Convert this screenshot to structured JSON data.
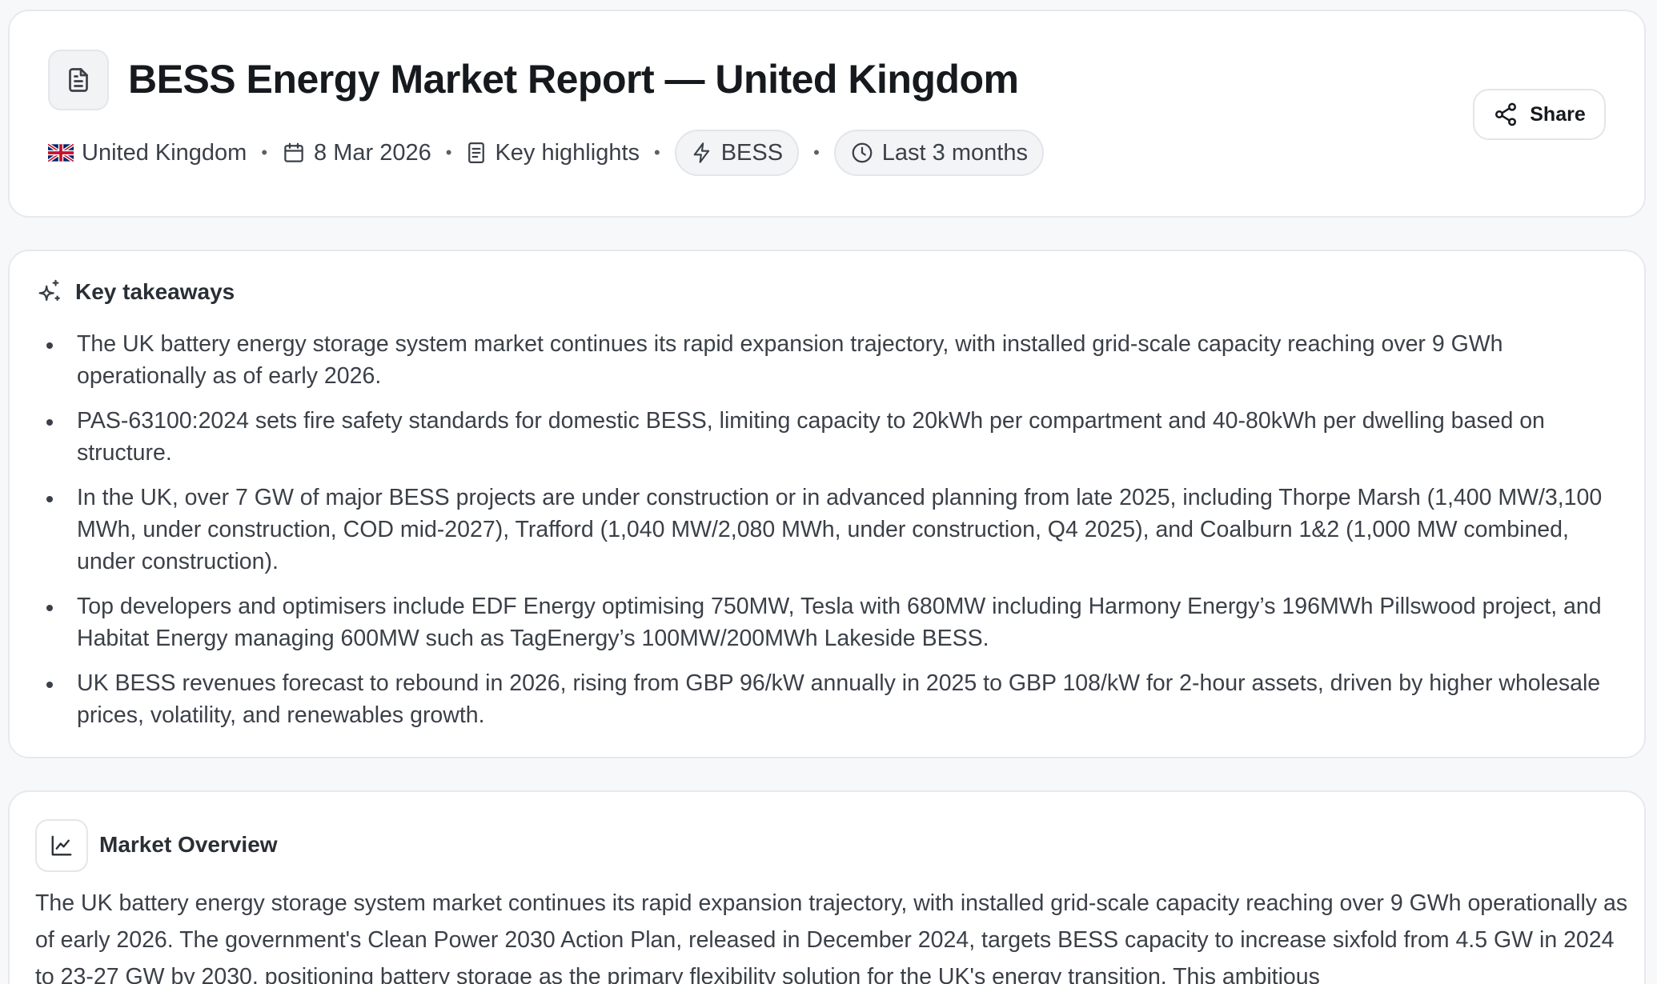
{
  "header": {
    "title": "BESS Energy Market Report — United Kingdom",
    "meta": {
      "country": "United Kingdom",
      "date": "8 Mar 2026",
      "type": "Key highlights",
      "tag": "BESS",
      "period": "Last 3 months",
      "separator": "•"
    },
    "share_label": "Share"
  },
  "takeaways": {
    "title": "Key takeaways",
    "items": [
      "The UK battery energy storage system market continues its rapid expansion trajectory, with installed grid-scale capacity reaching over 9 GWh operationally as of early 2026.",
      "PAS-63100:2024 sets fire safety standards for domestic BESS, limiting capacity to 20kWh per compartment and 40-80kWh per dwelling based on structure.",
      "In the UK, over 7 GW of major BESS projects are under construction or in advanced planning from late 2025, including Thorpe Marsh (1,400 MW/3,100 MWh, under construction, COD mid-2027), Trafford (1,040 MW/2,080 MWh, under construction, Q4 2025), and Coalburn 1&2 (1,000 MW combined, under construction).",
      "Top developers and optimisers include EDF Energy optimising 750MW, Tesla with 680MW including Harmony Energy’s 196MWh Pillswood project, and Habitat Energy managing 600MW such as TagEnergy’s 100MW/200MWh Lakeside BESS.",
      "UK BESS revenues forecast to rebound in 2026, rising from GBP 96/kW annually in 2025 to GBP 108/kW for 2-hour assets, driven by higher wholesale prices, volatility, and renewables growth."
    ]
  },
  "overview": {
    "title": "Market Overview",
    "body": "The UK battery energy storage system market continues its rapid expansion trajectory, with installed grid-scale capacity reaching over 9 GWh operationally as of early 2026. The government's Clean Power 2030 Action Plan, released in December 2024, targets BESS capacity to increase sixfold from 4.5 GW in 2024 to 23-27 GW by 2030, positioning battery storage as the primary flexibility solution for the UK's energy transition. This ambitious"
  }
}
